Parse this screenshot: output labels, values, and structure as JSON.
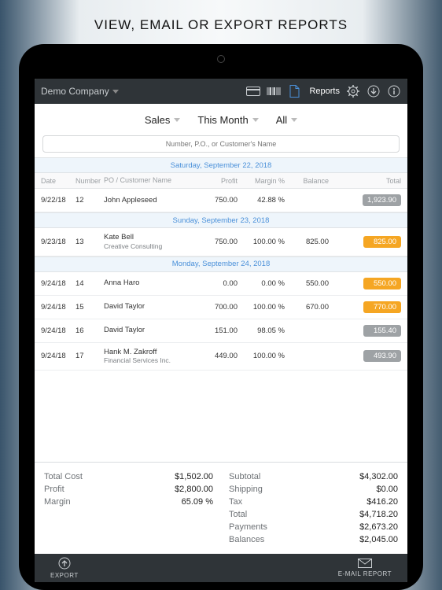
{
  "banner": "VIEW, EMAIL OR EXPORT REPORTS",
  "header": {
    "company": "Demo Company",
    "reports_label": "Reports"
  },
  "filters": {
    "f1": "Sales",
    "f2": "This Month",
    "f3": "All"
  },
  "search": {
    "placeholder": "Number, P.O., or Customer's Name"
  },
  "columns": {
    "date": "Date",
    "number": "Number",
    "cust": "PO / Customer Name",
    "profit": "Profit",
    "margin": "Margin %",
    "balance": "Balance",
    "total": "Total"
  },
  "sections": [
    {
      "date": "Saturday, September 22, 2018",
      "rows": [
        {
          "date": "9/22/18",
          "num": "12",
          "cust": "John Appleseed",
          "sub": "",
          "profit": "750.00",
          "margin": "42.88 %",
          "balance": "",
          "total": "1,923.90",
          "cls": "gray"
        }
      ]
    },
    {
      "date": "Sunday, September 23, 2018",
      "rows": [
        {
          "date": "9/23/18",
          "num": "13",
          "cust": "Kate Bell",
          "sub": "Creative Consulting",
          "profit": "750.00",
          "margin": "100.00 %",
          "balance": "825.00",
          "total": "825.00",
          "cls": "orange"
        }
      ]
    },
    {
      "date": "Monday, September 24, 2018",
      "rows": [
        {
          "date": "9/24/18",
          "num": "14",
          "cust": "Anna Haro",
          "sub": "",
          "profit": "0.00",
          "margin": "0.00 %",
          "balance": "550.00",
          "total": "550.00",
          "cls": "orange"
        },
        {
          "date": "9/24/18",
          "num": "15",
          "cust": "David Taylor",
          "sub": "",
          "profit": "700.00",
          "margin": "100.00 %",
          "balance": "670.00",
          "total": "770.00",
          "cls": "orange"
        },
        {
          "date": "9/24/18",
          "num": "16",
          "cust": "David Taylor",
          "sub": "",
          "profit": "151.00",
          "margin": "98.05 %",
          "balance": "",
          "total": "155.40",
          "cls": "gray"
        },
        {
          "date": "9/24/18",
          "num": "17",
          "cust": "Hank M. Zakroff",
          "sub": "Financial Services Inc.",
          "profit": "449.00",
          "margin": "100.00 %",
          "balance": "",
          "total": "493.90",
          "cls": "gray"
        }
      ]
    }
  ],
  "summary_left": [
    {
      "label": "Total Cost",
      "value": "$1,502.00"
    },
    {
      "label": "Profit",
      "value": "$2,800.00"
    },
    {
      "label": "Margin",
      "value": "65.09 %"
    }
  ],
  "summary_right": [
    {
      "label": "Subtotal",
      "value": "$4,302.00"
    },
    {
      "label": "Shipping",
      "value": "$0.00"
    },
    {
      "label": "Tax",
      "value": "$416.20"
    },
    {
      "label": "Total",
      "value": "$4,718.20"
    },
    {
      "label": "Payments",
      "value": "$2,673.20"
    },
    {
      "label": "Balances",
      "value": "$2,045.00"
    }
  ],
  "footer": {
    "export": "EXPORT",
    "email": "E-MAIL REPORT"
  }
}
